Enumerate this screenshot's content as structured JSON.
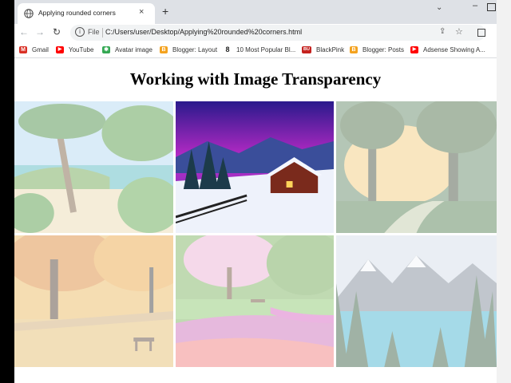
{
  "tab": {
    "title": "Applying rounded corners",
    "close": "×",
    "new_tab": "+"
  },
  "toolbar": {
    "back": "←",
    "forward": "→",
    "reload": "↻",
    "info": "i",
    "file_label": "File",
    "url": "C:/Users/user/Desktop/Applying%20rounded%20corners.html"
  },
  "bookmarks": [
    {
      "label": "Gmail",
      "icon": "gmail-icon",
      "color": "#d93025",
      "glyph": "M"
    },
    {
      "label": "YouTube",
      "icon": "youtube-icon",
      "color": "#ff0000",
      "glyph": "▶"
    },
    {
      "label": "Avatar image",
      "icon": "pinwheel-icon",
      "color": "#34a853",
      "glyph": "✱"
    },
    {
      "label": "Blogger: Layout",
      "icon": "blogger-icon",
      "color": "#f4a21e",
      "glyph": "B"
    },
    {
      "label": "10 Most Popular Bl...",
      "icon": "link-icon",
      "color": "#222222",
      "glyph": "8"
    },
    {
      "label": "BlackPink",
      "icon": "bu-icon",
      "color": "#c5221f",
      "glyph": "BU"
    },
    {
      "label": "Blogger: Posts",
      "icon": "blogger-icon",
      "color": "#f4a21e",
      "glyph": "B"
    },
    {
      "label": "Adsense Showing A...",
      "icon": "youtube-icon",
      "color": "#ff0000",
      "glyph": "▶"
    }
  ],
  "page": {
    "heading": "Working with Image Transparency"
  },
  "gallery": [
    {
      "scene": "tropical-beach",
      "opacity": 0.42
    },
    {
      "scene": "snowy-cabin",
      "opacity": 1.0
    },
    {
      "scene": "misty-forest",
      "opacity": 0.42
    },
    {
      "scene": "autumn-park",
      "opacity": 0.42
    },
    {
      "scene": "flower-garden",
      "opacity": 0.42
    },
    {
      "scene": "mountain-lake",
      "opacity": 0.42
    }
  ]
}
